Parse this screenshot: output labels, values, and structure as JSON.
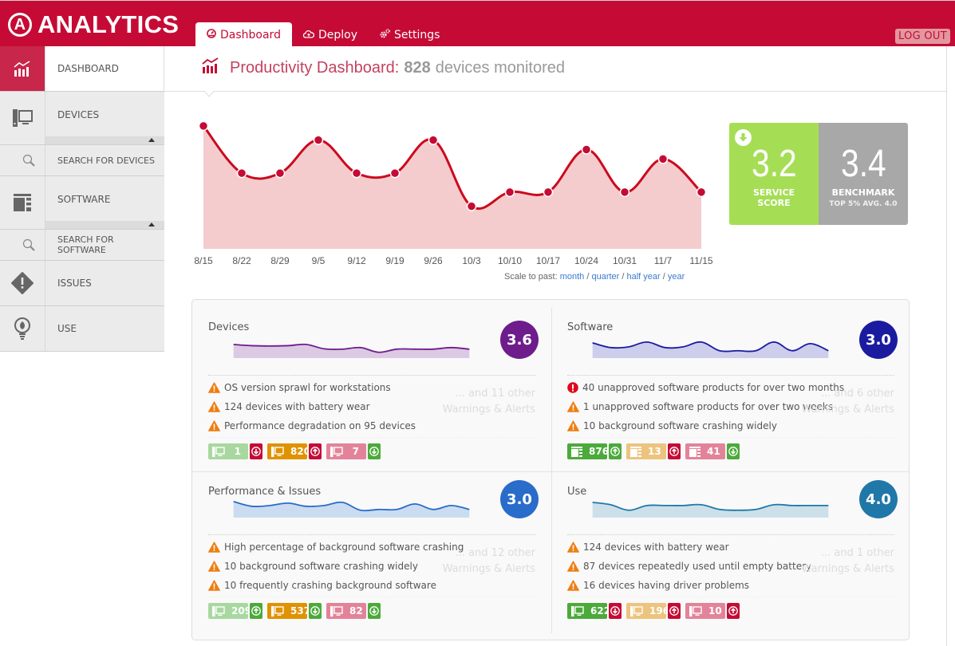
{
  "app": {
    "logo_text": "ANALYTICS",
    "logo_mark": "A"
  },
  "tabs": [
    {
      "label": "Dashboard",
      "icon": "gauge-icon",
      "active": true
    },
    {
      "label": "Deploy",
      "icon": "cloud-upload-icon",
      "active": false
    },
    {
      "label": "Settings",
      "icon": "gears-icon",
      "active": false
    }
  ],
  "header": {
    "logout_label": "LOG OUT"
  },
  "sidebar": {
    "items": [
      {
        "label": "DASHBOARD",
        "icon": "chart-icon",
        "active": true
      },
      {
        "label": "DEVICES",
        "icon": "desktop-icon",
        "active": false
      },
      {
        "label": "SEARCH FOR DEVICES",
        "icon": "search-icon",
        "sub": true
      },
      {
        "label": "SOFTWARE",
        "icon": "software-icon",
        "active": false
      },
      {
        "label": "SEARCH FOR SOFTWARE",
        "icon": "search-icon",
        "sub": true
      },
      {
        "label": "ISSUES",
        "icon": "warning-diamond-icon",
        "active": false
      },
      {
        "label": "USE",
        "icon": "lightbulb-icon",
        "active": false
      }
    ]
  },
  "title": {
    "prefix": "Productivity Dashboard:",
    "count": "828",
    "suffix": "devices monitored"
  },
  "chart_data": {
    "type": "area",
    "title": "Productivity",
    "x": [
      "8/15",
      "8/22",
      "8/29",
      "9/5",
      "9/12",
      "9/19",
      "9/26",
      "10/3",
      "10/10",
      "10/17",
      "10/24",
      "10/31",
      "11/7",
      "11/15"
    ],
    "values": [
      3.9,
      3.4,
      3.4,
      3.75,
      3.4,
      3.4,
      3.75,
      3.05,
      3.2,
      3.2,
      3.65,
      3.2,
      3.55,
      3.2
    ],
    "ylim": [
      2.6,
      4.0
    ],
    "xlabel": "",
    "ylabel": "",
    "grid": false,
    "line_color": "#cc0a1e",
    "fill_color": "#f5cccd",
    "point_color": "#c50b35"
  },
  "scale": {
    "label": "Scale to past:",
    "options": [
      "month",
      "quarter",
      "half year",
      "year"
    ],
    "sep": " / "
  },
  "score": {
    "service_value": "3.2",
    "service_label_1": "SERVICE",
    "service_label_2": "SCORE",
    "service_trend": "down",
    "bench_value": "3.4",
    "bench_label": "BENCHMARK",
    "bench_sub": "TOP 5% AVG. 4.0"
  },
  "cards": [
    {
      "title": "Devices",
      "score": "3.6",
      "color": "#6e1c8c",
      "fill": "#dcc9e3",
      "spark": [
        0.7,
        0.62,
        0.6,
        0.62,
        0.7,
        0.42,
        0.4,
        0.5,
        0.2,
        0.4,
        0.4,
        0.4,
        0.5,
        0.4
      ],
      "alerts": [
        {
          "type": "warning",
          "text": "OS version sprawl for workstations"
        },
        {
          "type": "warning",
          "text": "124 devices with battery wear"
        },
        {
          "type": "warning",
          "text": "Performance degradation on 95 devices"
        }
      ],
      "more_1": "... and 11 other",
      "more_2": "Warnings & Alerts",
      "badges": [
        {
          "value": "1",
          "color": "#a8d8a0",
          "icon": "desktop-icon",
          "trend": "down",
          "trend_color": "#c50b35"
        },
        {
          "value": "820",
          "color": "#e09200",
          "icon": "desktop-icon",
          "trend": "up",
          "trend_color": "#c50b35"
        },
        {
          "value": "7",
          "color": "#e3839a",
          "icon": "desktop-icon",
          "trend": "down",
          "trend_color": "#4caa3b"
        }
      ]
    },
    {
      "title": "Software",
      "score": "3.0",
      "color": "#1b1ba0",
      "fill": "#cdcdec",
      "spark": [
        0.8,
        0.5,
        0.55,
        0.85,
        0.5,
        0.55,
        0.85,
        0.3,
        0.3,
        0.3,
        0.85,
        0.3,
        0.75,
        0.3
      ],
      "alerts": [
        {
          "type": "error",
          "text": "40 unapproved software products for over two months"
        },
        {
          "type": "warning",
          "text": "1 unapproved software products for over two weeks"
        },
        {
          "type": "warning",
          "text": "10 background software crashing widely"
        }
      ],
      "more_1": "... and 6 other",
      "more_2": "Warnings & Alerts",
      "badges": [
        {
          "value": "876",
          "color": "#4caa3b",
          "icon": "software-icon",
          "trend": "up",
          "trend_color": "#4caa3b"
        },
        {
          "value": "13",
          "color": "#ecc47e",
          "icon": "software-icon",
          "trend": "up",
          "trend_color": "#c50b35"
        },
        {
          "value": "41",
          "color": "#e3839a",
          "icon": "software-icon",
          "trend": "down",
          "trend_color": "#4caa3b"
        }
      ]
    },
    {
      "title": "Performance & Issues",
      "score": "3.0",
      "color": "#2a6cc9",
      "fill": "#cbdcf1",
      "spark": [
        0.85,
        0.55,
        0.6,
        0.75,
        0.55,
        0.6,
        0.8,
        0.3,
        0.35,
        0.35,
        0.7,
        0.35,
        0.6,
        0.35
      ],
      "alerts": [
        {
          "type": "warning",
          "text": "High percentage of background software crashing"
        },
        {
          "type": "warning",
          "text": "10 background software crashing widely"
        },
        {
          "type": "warning",
          "text": "10 frequently crashing background software"
        }
      ],
      "more_1": "... and 12 other",
      "more_2": "Warnings & Alerts",
      "badges": [
        {
          "value": "209",
          "color": "#a8d8a0",
          "icon": "desktop-icon",
          "trend": "up",
          "trend_color": "#4caa3b"
        },
        {
          "value": "537",
          "color": "#e09200",
          "icon": "desktop-icon",
          "trend": "down",
          "trend_color": "#4caa3b"
        },
        {
          "value": "82",
          "color": "#e3839a",
          "icon": "desktop-icon",
          "trend": "down",
          "trend_color": "#4caa3b"
        }
      ]
    },
    {
      "title": "Use",
      "score": "4.0",
      "color": "#1f78a8",
      "fill": "#cde0ea",
      "spark": [
        0.8,
        0.65,
        0.3,
        0.6,
        0.6,
        0.6,
        0.65,
        0.35,
        0.3,
        0.35,
        0.65,
        0.6,
        0.6,
        0.6
      ],
      "alerts": [
        {
          "type": "warning",
          "text": "124 devices with battery wear"
        },
        {
          "type": "warning",
          "text": "87 devices repeatedly used until empty battery"
        },
        {
          "type": "warning",
          "text": "16 devices having driver problems"
        }
      ],
      "more_1": "... and 1 other",
      "more_2": "Warnings & Alerts",
      "badges": [
        {
          "value": "622",
          "color": "#4caa3b",
          "icon": "desktop-icon",
          "trend": "down",
          "trend_color": "#c50b35"
        },
        {
          "value": "196",
          "color": "#ecc47e",
          "icon": "desktop-icon",
          "trend": "up",
          "trend_color": "#c50b35"
        },
        {
          "value": "10",
          "color": "#e3839a",
          "icon": "desktop-icon",
          "trend": "up",
          "trend_color": "#c50b35"
        }
      ]
    }
  ]
}
